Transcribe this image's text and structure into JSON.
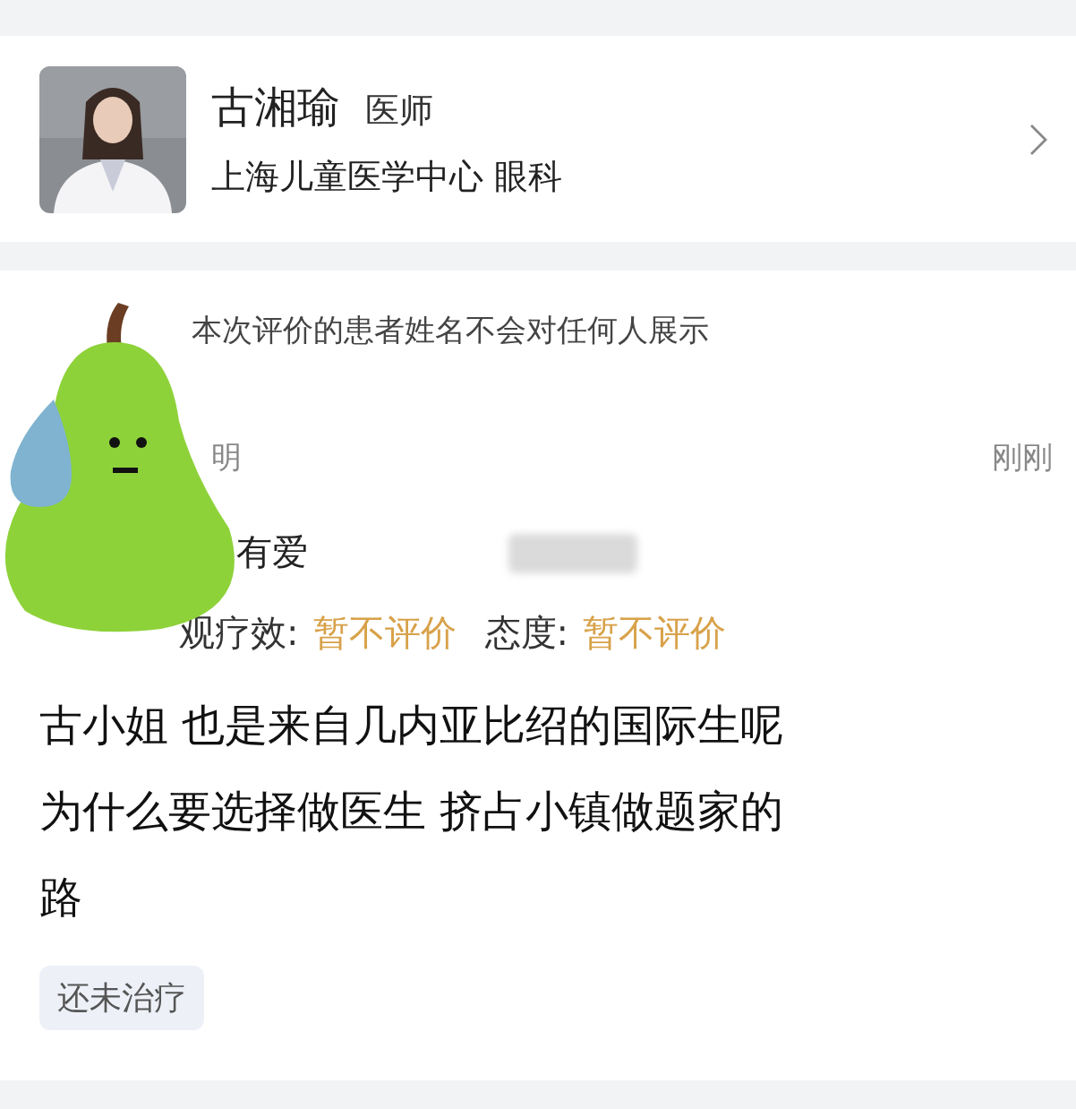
{
  "doctor": {
    "name": "古湘瑜",
    "title": "医师",
    "hospital": "上海儿童医学中心 眼科"
  },
  "review": {
    "notice": "本次评价的患者姓名不会对任何人展示",
    "reviewer_fragment": "明",
    "time": "刚刚",
    "reviewer": "有爱",
    "ratings": [
      {
        "label": "观疗效:",
        "value": "暂不评价"
      },
      {
        "label": "态度:",
        "value": "暂不评价"
      }
    ],
    "comment_lines": [
      "古小姐 也是来自几内亚比绍的国际生呢",
      "为什么要选择做医生 挤占小镇做题家的",
      "路"
    ],
    "tags": [
      "还未治疗"
    ]
  }
}
